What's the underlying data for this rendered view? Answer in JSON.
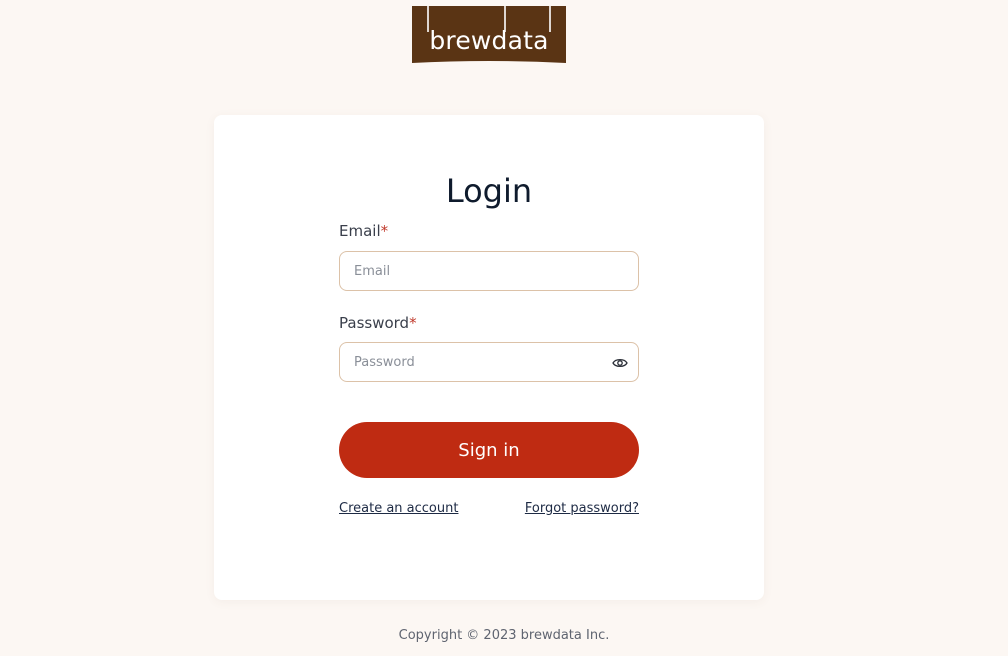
{
  "logo": {
    "text": "brewdata",
    "background_color": "#5a3414"
  },
  "login": {
    "title": "Login",
    "email": {
      "label": "Email",
      "required_mark": "*",
      "placeholder": "Email",
      "value": ""
    },
    "password": {
      "label": "Password",
      "required_mark": "*",
      "placeholder": "Password",
      "value": "",
      "toggle_icon": "eye-icon"
    },
    "sign_in_label": "Sign in",
    "create_account_label": "Create an account",
    "forgot_password_label": "Forgot password?"
  },
  "footer": {
    "copyright": "Copyright © 2023 brewdata Inc."
  },
  "colors": {
    "page_background": "#fcf7f3",
    "card_background": "#ffffff",
    "accent": "#bf2b12",
    "required": "#c0392b",
    "input_border": "#dcc2a8"
  }
}
